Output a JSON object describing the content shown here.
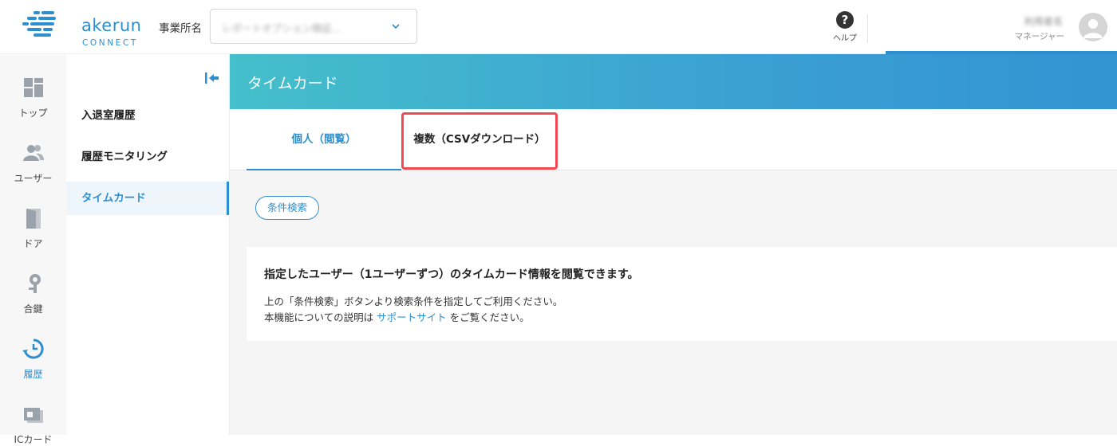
{
  "header": {
    "logo_text": "akerun",
    "logo_sub": "CONNECT",
    "office_label": "事業所名",
    "office_value": "レポートオプション検証...",
    "help_label": "ヘルプ",
    "user_name": "利用者名",
    "user_role": "マネージャー"
  },
  "rail": {
    "items": [
      {
        "label": "トップ",
        "icon": "dashboard-icon"
      },
      {
        "label": "ユーザー",
        "icon": "users-icon"
      },
      {
        "label": "ドア",
        "icon": "door-icon"
      },
      {
        "label": "合鍵",
        "icon": "key-icon"
      },
      {
        "label": "履歴",
        "icon": "history-icon",
        "active": true
      },
      {
        "label": "ICカード",
        "icon": "card-icon"
      }
    ]
  },
  "subnav": {
    "items": [
      {
        "label": "入退室履歴"
      },
      {
        "label": "履歴モニタリング"
      },
      {
        "label": "タイムカード",
        "active": true
      }
    ]
  },
  "main": {
    "title": "タイムカード",
    "tabs": [
      {
        "label": "個人（閲覧）",
        "active": true
      },
      {
        "label": "複数（CSVダウンロード）"
      }
    ],
    "filter_button": "条件検索",
    "info": {
      "title": "指定したユーザー（1ユーザーずつ）のタイムカード情報を閲覧できます。",
      "line1": "上の「条件検索」ボタンより検索条件を指定してご利用ください。",
      "line2_prefix": "本機能についての説明は",
      "line2_link": "サポートサイト",
      "line2_suffix": "をご覧ください。"
    }
  },
  "colors": {
    "accent": "#2e8fd0",
    "highlight": "#f04b55"
  }
}
